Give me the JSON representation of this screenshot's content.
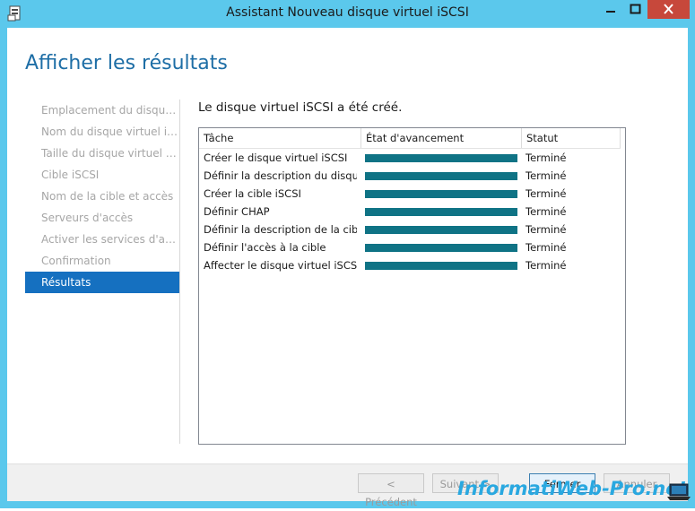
{
  "window": {
    "title": "Assistant Nouveau disque virtuel iSCSI",
    "accent_color": "#5bc8ec"
  },
  "page": {
    "heading": "Afficher les résultats",
    "message": "Le disque virtuel iSCSI a été créé."
  },
  "steps": [
    {
      "label": "Emplacement du disque..."
    },
    {
      "label": "Nom du disque virtuel iS..."
    },
    {
      "label": "Taille du disque virtuel iSC..."
    },
    {
      "label": "Cible iSCSI"
    },
    {
      "label": "Nom de la cible et accès"
    },
    {
      "label": "Serveurs d'accès"
    },
    {
      "label": "Activer les services d'auth..."
    },
    {
      "label": "Confirmation"
    },
    {
      "label": "Résultats",
      "active": true
    }
  ],
  "table": {
    "headers": [
      "Tâche",
      "État d'avancement",
      "Statut"
    ],
    "rows": [
      {
        "task": "Créer le disque virtuel iSCSI",
        "progress": 1.0,
        "status": "Terminé"
      },
      {
        "task": "Définir la description du disque virtuel iSCSI",
        "progress": 1.0,
        "status": "Terminé"
      },
      {
        "task": "Créer la cible iSCSI",
        "progress": 1.0,
        "status": "Terminé"
      },
      {
        "task": "Définir CHAP",
        "progress": 1.0,
        "status": "Terminé"
      },
      {
        "task": "Définir la description de la cible",
        "progress": 1.0,
        "status": "Terminé"
      },
      {
        "task": "Définir l'accès à la cible",
        "progress": 1.0,
        "status": "Terminé"
      },
      {
        "task": "Affecter le disque virtuel iSCSI à",
        "progress": 1.0,
        "status": "Terminé"
      }
    ],
    "progress_color": "#0f7385"
  },
  "buttons": {
    "previous": "< Précédent",
    "next": "Suivant >",
    "close": "Fermer",
    "cancel": "Annuler"
  },
  "watermark": {
    "text": "InformatiWeb-Pro.net"
  }
}
